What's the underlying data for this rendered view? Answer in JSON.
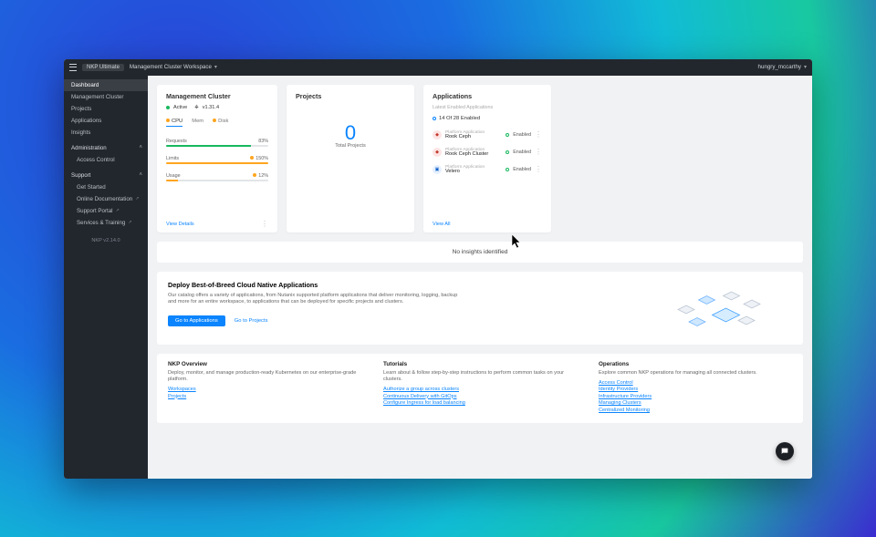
{
  "topbar": {
    "product_badge": "NKP Ultimate",
    "workspace": "Management Cluster Workspace",
    "user": "hungry_mccarthy"
  },
  "sidebar": {
    "items": [
      {
        "label": "Dashboard",
        "active": true
      },
      {
        "label": "Management Cluster"
      },
      {
        "label": "Projects"
      },
      {
        "label": "Applications"
      },
      {
        "label": "Insights"
      }
    ],
    "admin_header": "Administration",
    "admin_items": [
      {
        "label": "Access Control"
      }
    ],
    "support_header": "Support",
    "support_items": [
      {
        "label": "Get Started"
      },
      {
        "label": "Online Documentation",
        "ext": true
      },
      {
        "label": "Support Portal",
        "ext": true
      },
      {
        "label": "Services & Training",
        "ext": true
      }
    ],
    "version": "NKP v2.14.0"
  },
  "mgmt": {
    "title": "Management Cluster",
    "status": "Active",
    "k8s_version": "v1.31.4",
    "tabs": {
      "cpu": "CPU",
      "mem": "Mem",
      "disk": "Disk"
    },
    "rows": {
      "requests": {
        "label": "Requests",
        "value": "83%",
        "pct": 83,
        "color": "#18b85e"
      },
      "limits": {
        "label": "Limits",
        "value": "150%",
        "pct": 100,
        "color": "#ffa51f",
        "dot": true
      },
      "usage": {
        "label": "Usage",
        "value": "12%",
        "pct": 12,
        "color": "#ffa51f",
        "dot": true
      }
    },
    "view": "View Details"
  },
  "projects": {
    "title": "Projects",
    "total_value": "0",
    "total_caption": "Total Projects"
  },
  "apps": {
    "title": "Applications",
    "subtitle": "Latest Enabled Applications",
    "enabled_summary": "14 Of 28 Enabled",
    "kind_label": "Platform Application",
    "items": [
      {
        "name": "Rook Ceph",
        "status": "Enabled",
        "icon": "ceph"
      },
      {
        "name": "Rook Ceph Cluster",
        "status": "Enabled",
        "icon": "ceph"
      },
      {
        "name": "Velero",
        "status": "Enabled",
        "icon": "vel"
      }
    ],
    "view": "View All"
  },
  "insights": {
    "empty_text": "No insights identified"
  },
  "deploy": {
    "title": "Deploy Best-of-Breed Cloud Native Applications",
    "desc": "Our catalog offers a variety of applications, from Nutanix supported platform applications that deliver monitoring, logging, backup and more for an entire workspace, to applications that can be deployed for specific projects and clusters.",
    "go_apps": "Go to Applications",
    "go_projects": "Go to Projects"
  },
  "footer": {
    "overview": {
      "title": "NKP Overview",
      "desc": "Deploy, monitor, and manage production-ready Kubernetes on our enterprise-grade platform.",
      "links": [
        "Workspaces",
        "Projects"
      ]
    },
    "tutorials": {
      "title": "Tutorials",
      "desc": "Learn about & follow step-by-step instructions to perform common tasks on your clusters.",
      "links": [
        "Authorize a group across clusters",
        "Continuous Delivery with GitOps",
        "Configure Ingress for load balancing"
      ]
    },
    "operations": {
      "title": "Operations",
      "desc": "Explore common NKP operations for managing all connected clusters.",
      "links": [
        "Access Control",
        "Identity Providers",
        "Infrastructure Providers",
        "Managing Clusters",
        "Centralized Monitoring"
      ]
    }
  }
}
